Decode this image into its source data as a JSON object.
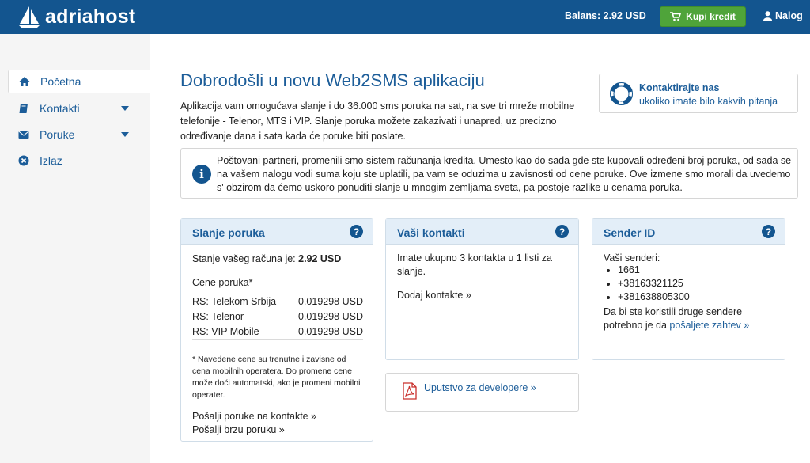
{
  "header": {
    "brand": "adriahost",
    "balance": "Balans: 2.92 USD",
    "buy_credit": "Kupi kredit",
    "account": "Nalog"
  },
  "sidebar": {
    "items": [
      {
        "label": "Početna",
        "icon": "home-icon"
      },
      {
        "label": "Kontakti",
        "icon": "book-icon"
      },
      {
        "label": "Poruke",
        "icon": "envelope-icon"
      },
      {
        "label": "Izlaz",
        "icon": "close-circle-icon"
      }
    ]
  },
  "main": {
    "title": "Dobrodošli u novu Web2SMS aplikaciju",
    "intro": "Aplikacija vam omogućava slanje i do 36.000 sms poruka na sat, na sve tri mreže mobilne telefonije - Telenor, MTS i VIP. Slanje poruka možete zakazivati i unapred, uz precizno određivanje dana i sata kada će poruke biti poslate."
  },
  "contact": {
    "title": "Kontaktirajte nas",
    "subtitle": "ukoliko imate bilo kakvih pitanja"
  },
  "notice": {
    "text": "Poštovani partneri, promenili smo sistem računanja kredita. Umesto kao do sada gde ste kupovali određeni broj poruka, od sada se na vašem nalogu vodi suma koju ste uplatili, pa vam se oduzima u zavisnosti od cene poruke. Ove izmene smo morali da uvedemo s' obzirom da ćemo uskoro ponuditi slanje u mnogim zemljama sveta, pa postoje razlike u cenama poruka."
  },
  "sending": {
    "title": "Slanje poruka",
    "balance_label": "Stanje vašeg računa je:",
    "balance_value": "2.92 USD",
    "prices_label": "Cene poruka*",
    "prices": [
      {
        "network": "RS: Telekom Srbija",
        "price": "0.019298 USD"
      },
      {
        "network": "RS: Telenor",
        "price": "0.019298 USD"
      },
      {
        "network": "RS: VIP Mobile",
        "price": "0.019298 USD"
      }
    ],
    "footnote": "* Navedene cene su trenutne i zavisne od cena mobilnih operatera. Do promene cene može doći automatski, ako je promeni mobilni operater.",
    "link_contacts": "Pošalji poruke na kontakte »",
    "link_quick": "Pošalji brzu poruku »"
  },
  "contacts": {
    "title": "Vaši kontakti",
    "text": "Imate ukupno 3 kontakta u 1 listi za slanje.",
    "link_add": "Dodaj kontakte »"
  },
  "sender": {
    "title": "Sender ID",
    "label": "Vaši senderi:",
    "items": [
      "1661",
      "+38163321125",
      "+381638805300"
    ],
    "note": "Da bi ste koristili druge sendere potrebno je da",
    "link": "pošaljete zahtev »"
  },
  "developer": {
    "label": "Uputstvo za developere »"
  },
  "colors": {
    "header_bg": "#13558f",
    "accent": "#1c5d99",
    "buy_green": "#4fa43a",
    "card_head": "#e3eef8"
  }
}
